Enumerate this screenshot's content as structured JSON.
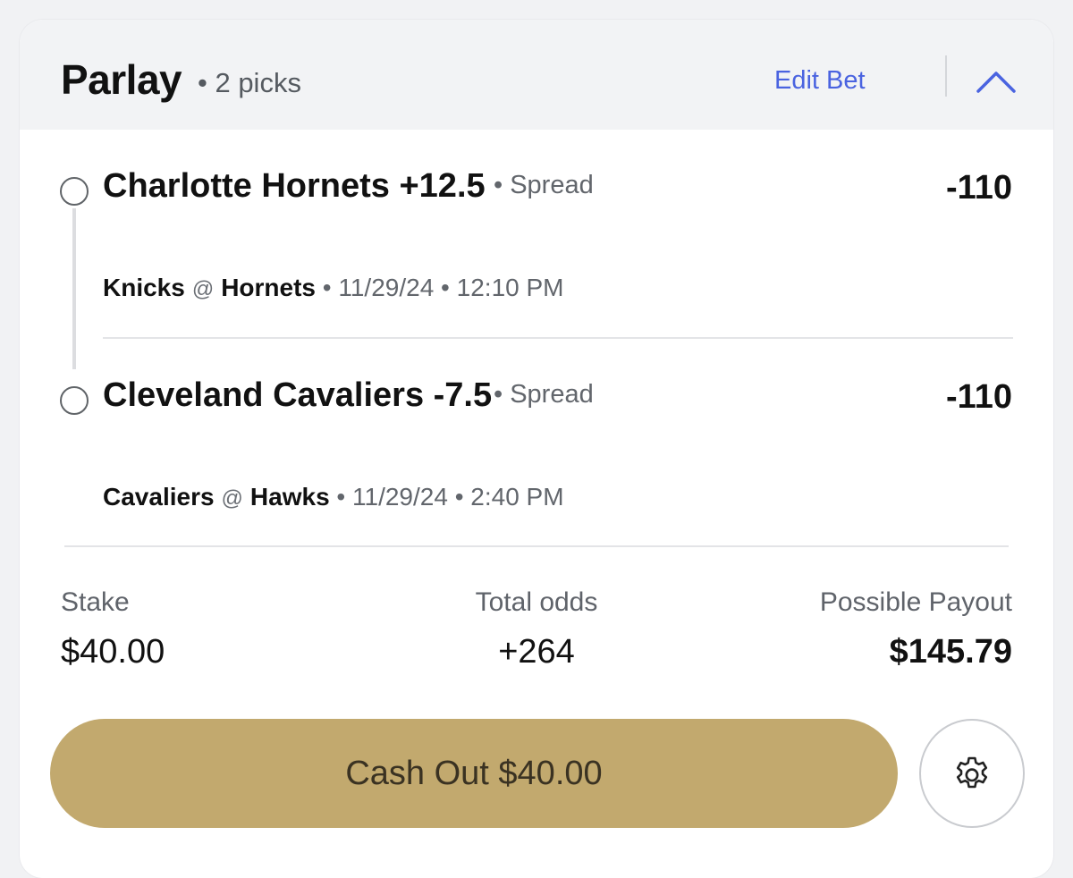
{
  "header": {
    "title": "Parlay",
    "picks_count": "• 2 picks",
    "edit_label": "Edit Bet"
  },
  "picks": [
    {
      "selection": "Charlotte Hornets +12.5",
      "market": "• Spread",
      "odds": "-110",
      "away_team": "Knicks",
      "at_symbol": "@",
      "home_team": "Hornets",
      "meta": "• 11/29/24 • 12:10 PM"
    },
    {
      "selection": "Cleveland Cavaliers -7.5",
      "market": "• Spread",
      "odds": "-110",
      "away_team": "Cavaliers",
      "at_symbol": "@",
      "home_team": "Hawks",
      "meta": "• 11/29/24 • 2:40 PM"
    }
  ],
  "summary": {
    "stake_label": "Stake",
    "stake_value": "$40.00",
    "odds_label": "Total odds",
    "odds_value": "+264",
    "payout_label": "Possible Payout",
    "payout_value": "$145.79"
  },
  "actions": {
    "cashout_label": "Cash Out $40.00",
    "settings_icon": "gear-icon",
    "collapse_icon": "chevron-up-icon"
  },
  "colors": {
    "accent": "#4a63e0",
    "cashout_bg": "#c2a96e",
    "header_bg": "#f2f3f5"
  }
}
